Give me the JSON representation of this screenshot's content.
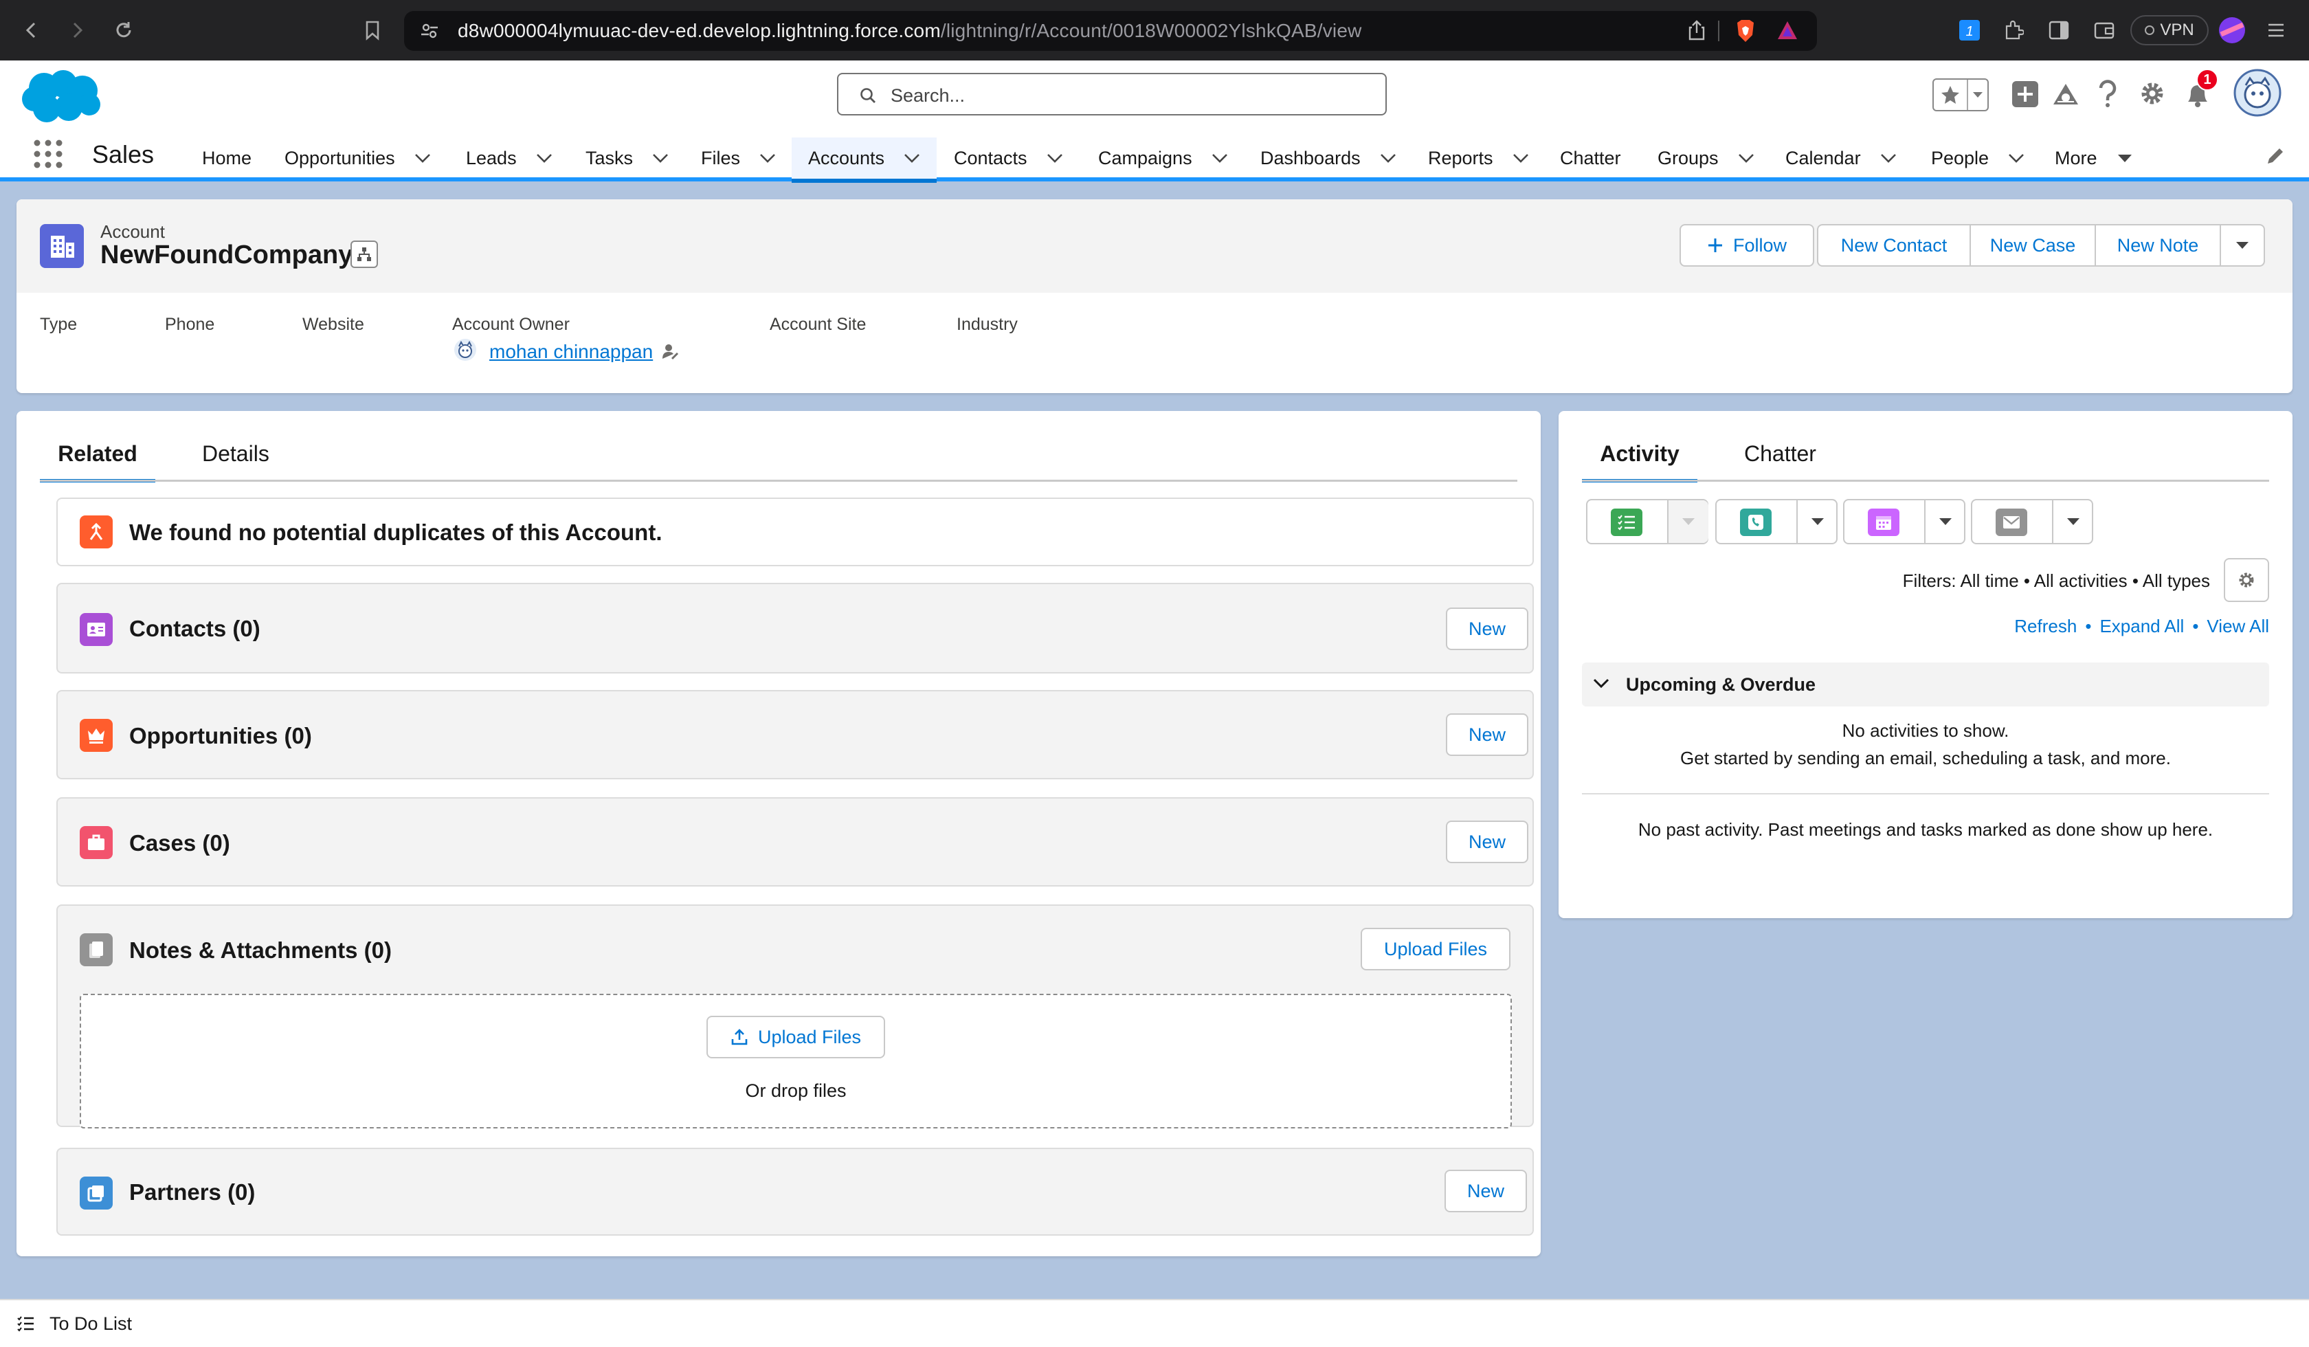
{
  "browser": {
    "url_host": "d8w000004lymuuac-dev-ed.develop.lightning.force.com",
    "url_path": "/lightning/r/Account/0018W00002YlshkQAB/view",
    "vpn_label": "VPN",
    "notification_count": "1"
  },
  "header": {
    "search_placeholder": "Search...",
    "app_name": "Sales",
    "nav": [
      {
        "label": "Home"
      },
      {
        "label": "Opportunities"
      },
      {
        "label": "Leads"
      },
      {
        "label": "Tasks"
      },
      {
        "label": "Files"
      },
      {
        "label": "Accounts"
      },
      {
        "label": "Contacts"
      },
      {
        "label": "Campaigns"
      },
      {
        "label": "Dashboards"
      },
      {
        "label": "Reports"
      },
      {
        "label": "Chatter"
      },
      {
        "label": "Groups"
      },
      {
        "label": "Calendar"
      },
      {
        "label": "People"
      },
      {
        "label": "More"
      }
    ]
  },
  "record": {
    "object_label": "Account",
    "name": "NewFoundCompany",
    "actions": {
      "follow": "Follow",
      "new_contact": "New Contact",
      "new_case": "New Case",
      "new_note": "New Note"
    },
    "fields": {
      "type": "Type",
      "phone": "Phone",
      "website": "Website",
      "account_owner": "Account Owner",
      "owner_name": "mohan chinnappan",
      "account_site": "Account Site",
      "industry": "Industry"
    }
  },
  "related": {
    "tabs": {
      "related": "Related",
      "details": "Details"
    },
    "duplicates_msg": "We found no potential duplicates of this Account.",
    "new_label": "New",
    "upload_label": "Upload Files",
    "drop_label": "Or drop files",
    "lists": {
      "contacts": "Contacts (0)",
      "opportunities": "Opportunities (0)",
      "cases": "Cases (0)",
      "notes": "Notes & Attachments (0)",
      "partners": "Partners (0)"
    }
  },
  "activity": {
    "tabs": {
      "activity": "Activity",
      "chatter": "Chatter"
    },
    "filters": "Filters: All time • All activities • All types",
    "refresh": "Refresh",
    "expand_all": "Expand All",
    "view_all": "View All",
    "dot": "•",
    "section": "Upcoming & Overdue",
    "empty_line1": "No activities to show.",
    "empty_line2": "Get started by sending an email, scheduling a task, and more.",
    "past": "No past activity. Past meetings and tasks marked as done show up here."
  },
  "footer": {
    "todo": "To Do List"
  },
  "colors": {
    "brand_blue": "#0176d3",
    "page_bg": "#b0c4df",
    "account_icon": "#5a67d8",
    "contacts_icon": "#a94fd6",
    "opps_icon": "#ff5d2d",
    "cases_icon": "#f2536d",
    "task_green": "#3ba755",
    "call_teal": "#30a89b",
    "event_purple": "#cb65ff",
    "email_gray": "#939393"
  }
}
